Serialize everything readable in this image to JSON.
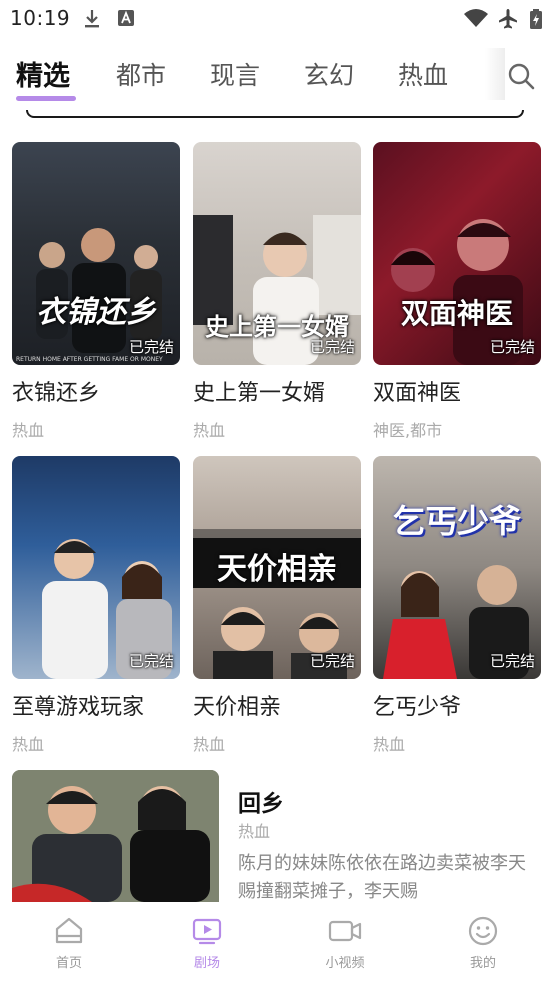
{
  "status_bar": {
    "time": "10:19"
  },
  "tabs": [
    {
      "label": "精选",
      "active": true
    },
    {
      "label": "都市",
      "active": false
    },
    {
      "label": "现言",
      "active": false
    },
    {
      "label": "玄幻",
      "active": false
    },
    {
      "label": "热血",
      "active": false
    }
  ],
  "colors": {
    "accent": "#b58ae8",
    "inactive": "#999999"
  },
  "dramas": [
    {
      "title": "衣锦还乡",
      "tags": "热血",
      "status": "已完结",
      "poster_text": "衣锦还乡",
      "poster_subtext": "RETURN HOME AFTER GETTING FAME OR MONEY"
    },
    {
      "title": "史上第一女婿",
      "tags": "热血",
      "status": "已完结",
      "poster_text": "史上第一女婿"
    },
    {
      "title": "双面神医",
      "tags": "神医,都市",
      "status": "已完结",
      "poster_text": "双面神医"
    },
    {
      "title": "至尊游戏玩家",
      "tags": "热血",
      "status": "已完结"
    },
    {
      "title": "天价相亲",
      "tags": "热血",
      "status": "已完结",
      "poster_text": "天价相亲"
    },
    {
      "title": "乞丐少爷",
      "tags": "热血",
      "status": "已完结",
      "poster_text": "乞丐少爷"
    }
  ],
  "featured": {
    "title": "回乡",
    "tags": "热血",
    "description": "陈月的妹妹陈依依在路边卖菜被李天赐撞翻菜摊子，李天赐"
  },
  "bottom_nav": [
    {
      "label": "首页",
      "icon": "home-icon",
      "active": false
    },
    {
      "label": "剧场",
      "icon": "theater-icon",
      "active": true
    },
    {
      "label": "小视频",
      "icon": "video-camera-icon",
      "active": false
    },
    {
      "label": "我的",
      "icon": "smiley-profile-icon",
      "active": false
    }
  ]
}
